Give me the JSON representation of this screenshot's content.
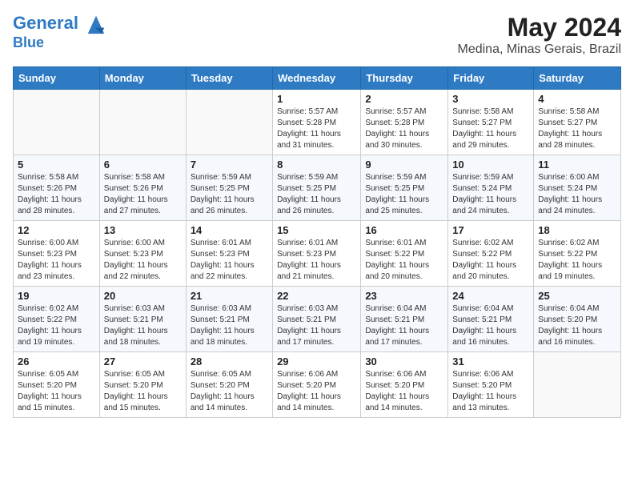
{
  "header": {
    "logo_line1": "General",
    "logo_line2": "Blue",
    "month_year": "May 2024",
    "location": "Medina, Minas Gerais, Brazil"
  },
  "days_of_week": [
    "Sunday",
    "Monday",
    "Tuesday",
    "Wednesday",
    "Thursday",
    "Friday",
    "Saturday"
  ],
  "weeks": [
    [
      {
        "day": "",
        "info": ""
      },
      {
        "day": "",
        "info": ""
      },
      {
        "day": "",
        "info": ""
      },
      {
        "day": "1",
        "info": "Sunrise: 5:57 AM\nSunset: 5:28 PM\nDaylight: 11 hours and 31 minutes."
      },
      {
        "day": "2",
        "info": "Sunrise: 5:57 AM\nSunset: 5:28 PM\nDaylight: 11 hours and 30 minutes."
      },
      {
        "day": "3",
        "info": "Sunrise: 5:58 AM\nSunset: 5:27 PM\nDaylight: 11 hours and 29 minutes."
      },
      {
        "day": "4",
        "info": "Sunrise: 5:58 AM\nSunset: 5:27 PM\nDaylight: 11 hours and 28 minutes."
      }
    ],
    [
      {
        "day": "5",
        "info": "Sunrise: 5:58 AM\nSunset: 5:26 PM\nDaylight: 11 hours and 28 minutes."
      },
      {
        "day": "6",
        "info": "Sunrise: 5:58 AM\nSunset: 5:26 PM\nDaylight: 11 hours and 27 minutes."
      },
      {
        "day": "7",
        "info": "Sunrise: 5:59 AM\nSunset: 5:25 PM\nDaylight: 11 hours and 26 minutes."
      },
      {
        "day": "8",
        "info": "Sunrise: 5:59 AM\nSunset: 5:25 PM\nDaylight: 11 hours and 26 minutes."
      },
      {
        "day": "9",
        "info": "Sunrise: 5:59 AM\nSunset: 5:25 PM\nDaylight: 11 hours and 25 minutes."
      },
      {
        "day": "10",
        "info": "Sunrise: 5:59 AM\nSunset: 5:24 PM\nDaylight: 11 hours and 24 minutes."
      },
      {
        "day": "11",
        "info": "Sunrise: 6:00 AM\nSunset: 5:24 PM\nDaylight: 11 hours and 24 minutes."
      }
    ],
    [
      {
        "day": "12",
        "info": "Sunrise: 6:00 AM\nSunset: 5:23 PM\nDaylight: 11 hours and 23 minutes."
      },
      {
        "day": "13",
        "info": "Sunrise: 6:00 AM\nSunset: 5:23 PM\nDaylight: 11 hours and 22 minutes."
      },
      {
        "day": "14",
        "info": "Sunrise: 6:01 AM\nSunset: 5:23 PM\nDaylight: 11 hours and 22 minutes."
      },
      {
        "day": "15",
        "info": "Sunrise: 6:01 AM\nSunset: 5:23 PM\nDaylight: 11 hours and 21 minutes."
      },
      {
        "day": "16",
        "info": "Sunrise: 6:01 AM\nSunset: 5:22 PM\nDaylight: 11 hours and 20 minutes."
      },
      {
        "day": "17",
        "info": "Sunrise: 6:02 AM\nSunset: 5:22 PM\nDaylight: 11 hours and 20 minutes."
      },
      {
        "day": "18",
        "info": "Sunrise: 6:02 AM\nSunset: 5:22 PM\nDaylight: 11 hours and 19 minutes."
      }
    ],
    [
      {
        "day": "19",
        "info": "Sunrise: 6:02 AM\nSunset: 5:22 PM\nDaylight: 11 hours and 19 minutes."
      },
      {
        "day": "20",
        "info": "Sunrise: 6:03 AM\nSunset: 5:21 PM\nDaylight: 11 hours and 18 minutes."
      },
      {
        "day": "21",
        "info": "Sunrise: 6:03 AM\nSunset: 5:21 PM\nDaylight: 11 hours and 18 minutes."
      },
      {
        "day": "22",
        "info": "Sunrise: 6:03 AM\nSunset: 5:21 PM\nDaylight: 11 hours and 17 minutes."
      },
      {
        "day": "23",
        "info": "Sunrise: 6:04 AM\nSunset: 5:21 PM\nDaylight: 11 hours and 17 minutes."
      },
      {
        "day": "24",
        "info": "Sunrise: 6:04 AM\nSunset: 5:21 PM\nDaylight: 11 hours and 16 minutes."
      },
      {
        "day": "25",
        "info": "Sunrise: 6:04 AM\nSunset: 5:20 PM\nDaylight: 11 hours and 16 minutes."
      }
    ],
    [
      {
        "day": "26",
        "info": "Sunrise: 6:05 AM\nSunset: 5:20 PM\nDaylight: 11 hours and 15 minutes."
      },
      {
        "day": "27",
        "info": "Sunrise: 6:05 AM\nSunset: 5:20 PM\nDaylight: 11 hours and 15 minutes."
      },
      {
        "day": "28",
        "info": "Sunrise: 6:05 AM\nSunset: 5:20 PM\nDaylight: 11 hours and 14 minutes."
      },
      {
        "day": "29",
        "info": "Sunrise: 6:06 AM\nSunset: 5:20 PM\nDaylight: 11 hours and 14 minutes."
      },
      {
        "day": "30",
        "info": "Sunrise: 6:06 AM\nSunset: 5:20 PM\nDaylight: 11 hours and 14 minutes."
      },
      {
        "day": "31",
        "info": "Sunrise: 6:06 AM\nSunset: 5:20 PM\nDaylight: 11 hours and 13 minutes."
      },
      {
        "day": "",
        "info": ""
      }
    ]
  ]
}
